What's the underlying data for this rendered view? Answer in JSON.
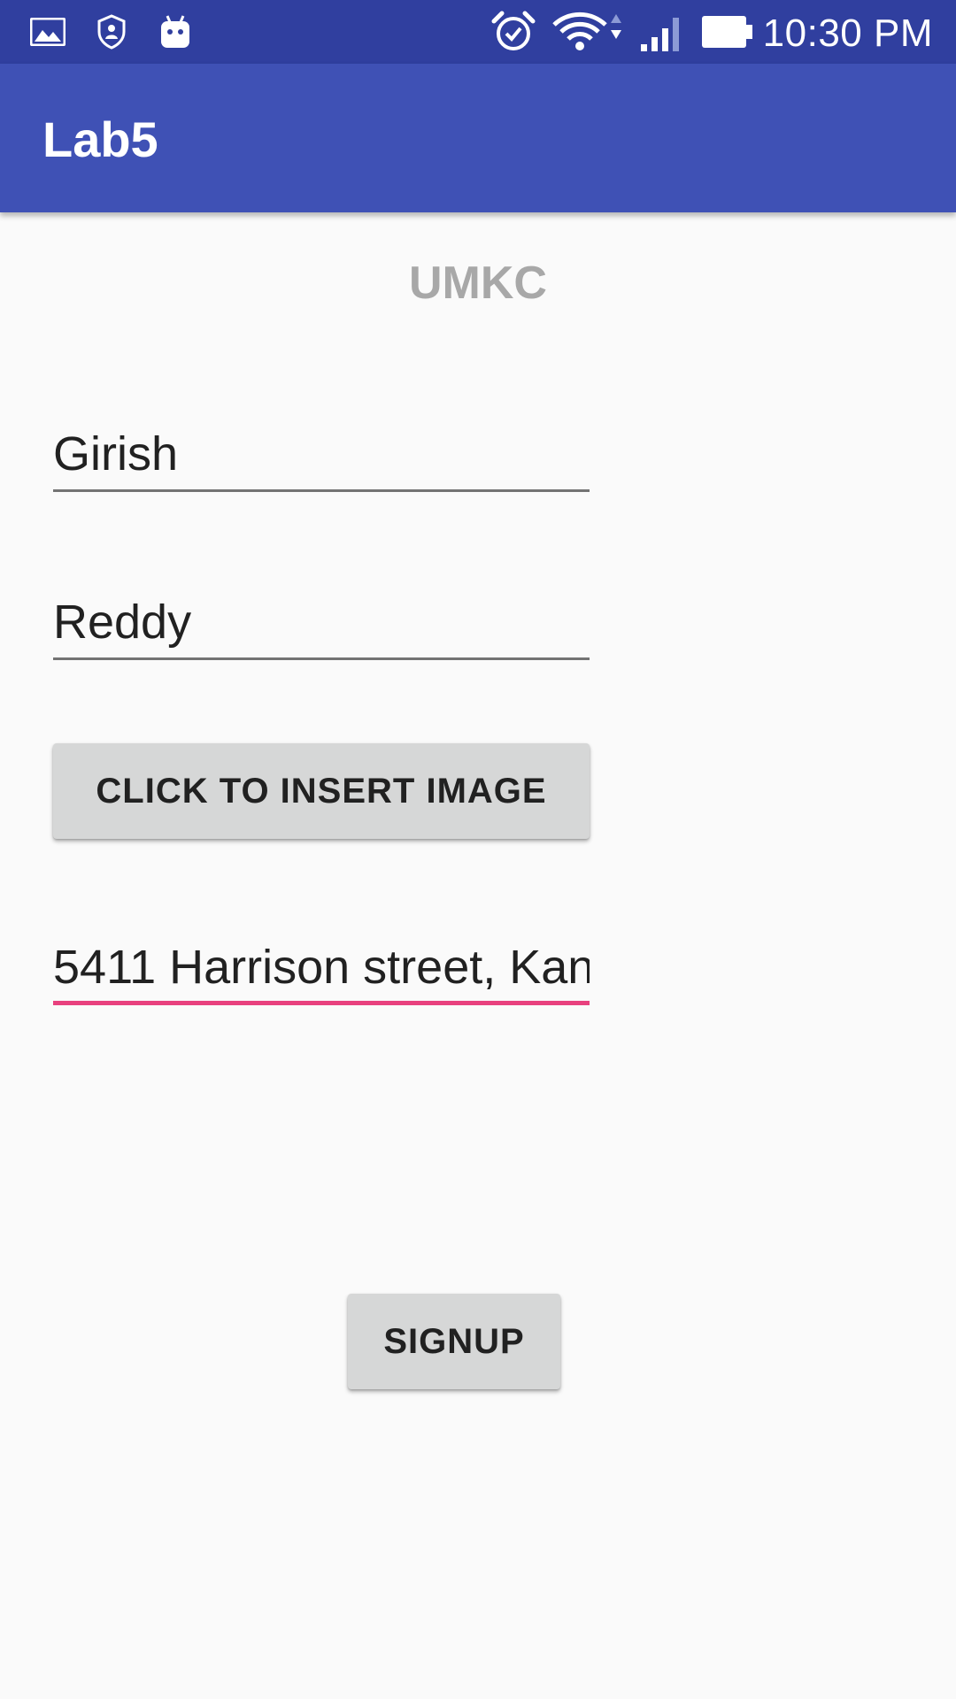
{
  "status_bar": {
    "time": "10:30 PM",
    "left_icons": [
      "image-icon",
      "shield-icon",
      "android-icon"
    ],
    "right_icons": [
      "alarm-icon",
      "wifi-icon",
      "cell-signal-icon",
      "battery-icon"
    ]
  },
  "app_bar": {
    "title": "Lab5",
    "color": "#3f51b5"
  },
  "form": {
    "heading": "UMKC",
    "first_name": "Girish",
    "last_name": "Reddy",
    "insert_image_label": "CLICK TO INSERT IMAGE",
    "address": "5411 Harrison street, Kan",
    "signup_label": "SIGNUP",
    "focus_color": "#e8417e"
  }
}
